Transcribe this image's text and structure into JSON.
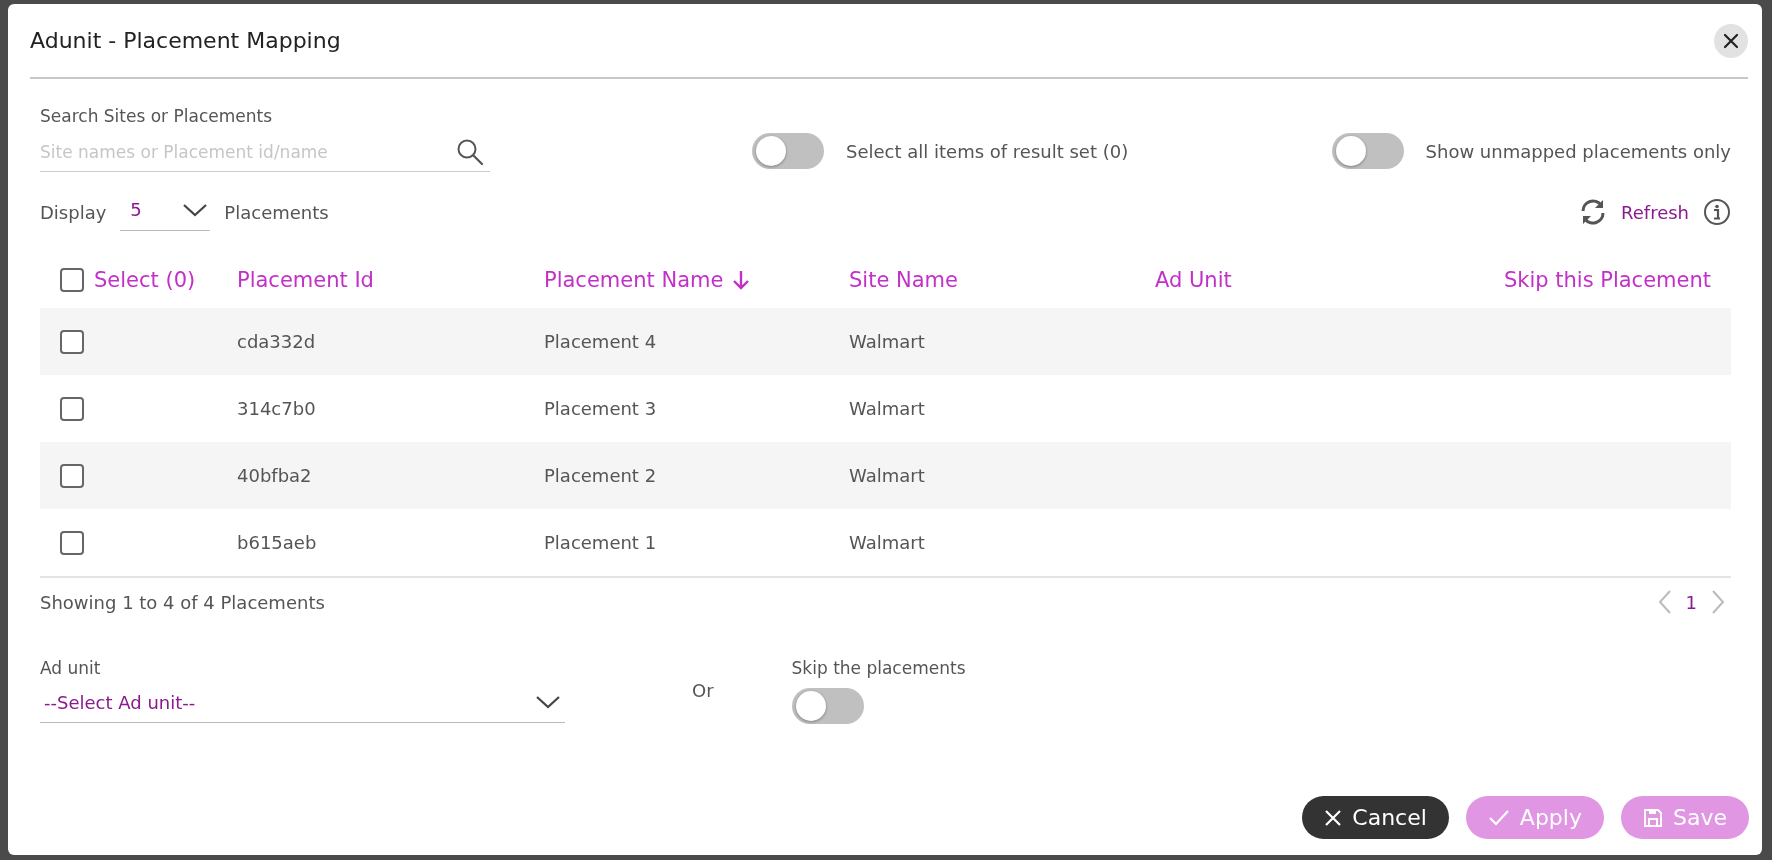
{
  "dialog": {
    "title": "Adunit - Placement Mapping"
  },
  "search": {
    "label": "Search Sites or Placements",
    "placeholder": "Site names or Placement id/name"
  },
  "toggles": [
    {
      "label": "Select all items of result set (0)",
      "on": false
    },
    {
      "label": "Show unmapped placements only",
      "on": false
    }
  ],
  "display": {
    "label": "Display",
    "value": "5",
    "suffix": "Placements"
  },
  "refresh": {
    "label": "Refresh"
  },
  "table": {
    "select_all": {
      "label": "Select (0)",
      "checked": false
    },
    "columns": [
      {
        "label": "Placement Id",
        "sorted": false
      },
      {
        "label": "Placement Name",
        "sorted": true
      },
      {
        "label": "Site Name",
        "sorted": false
      },
      {
        "label": "Ad Unit",
        "sorted": false
      },
      {
        "label": "Skip this Placement",
        "sorted": false
      }
    ],
    "rows": [
      {
        "checked": false,
        "placement_id": "cda332d",
        "placement_name": "Placement 4",
        "site_name": "Walmart"
      },
      {
        "checked": false,
        "placement_id": "314c7b0",
        "placement_name": "Placement 3",
        "site_name": "Walmart"
      },
      {
        "checked": false,
        "placement_id": "40bfba2",
        "placement_name": "Placement 2",
        "site_name": "Walmart"
      },
      {
        "checked": false,
        "placement_id": "b615aeb",
        "placement_name": "Placement 1",
        "site_name": "Walmart"
      }
    ]
  },
  "summary": "Showing 1 to 4 of 4 Placements",
  "pagination": {
    "pages": [
      {
        "label": "1",
        "selected": true
      }
    ]
  },
  "ad_unit": {
    "label": "Ad unit",
    "value": "--Select Ad unit--"
  },
  "or_label": "Or",
  "skip": {
    "label": "Skip the placements",
    "on": false
  },
  "buttons": [
    {
      "kind": "cancel",
      "label": "Cancel",
      "disabled": false
    },
    {
      "kind": "apply",
      "label": "Apply",
      "disabled": true
    },
    {
      "kind": "save",
      "label": "Save",
      "disabled": true
    }
  ]
}
